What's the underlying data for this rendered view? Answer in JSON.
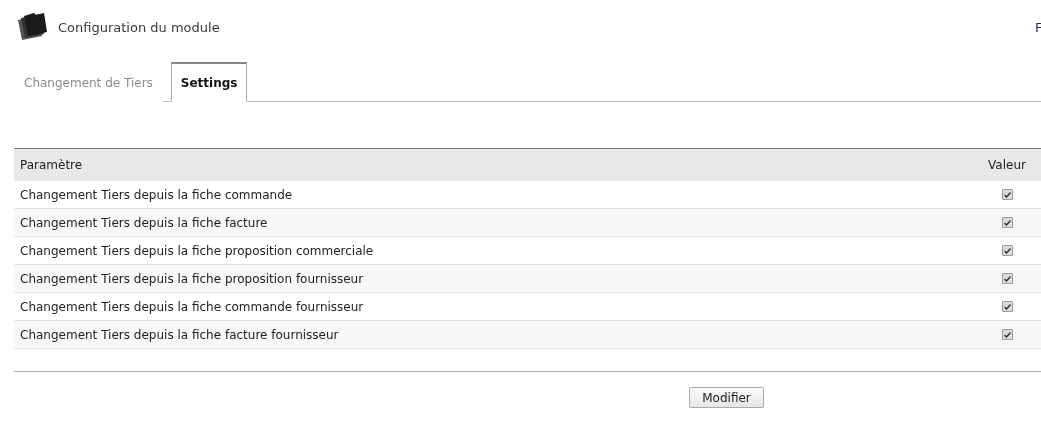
{
  "header": {
    "title": "Configuration du module",
    "right_link": "F"
  },
  "tabs": [
    {
      "label": "Changement de Tiers",
      "selected": false
    },
    {
      "label": "Settings",
      "selected": true
    }
  ],
  "table": {
    "columns": [
      "Paramètre",
      "Valeur"
    ],
    "rows": [
      {
        "label": "Changement Tiers depuis la fiche commande",
        "checked": true
      },
      {
        "label": "Changement Tiers depuis la fiche facture",
        "checked": true
      },
      {
        "label": "Changement Tiers depuis la fiche proposition commerciale",
        "checked": true
      },
      {
        "label": "Changement Tiers depuis la fiche proposition fournisseur",
        "checked": true
      },
      {
        "label": "Changement Tiers depuis la fiche commande fournisseur",
        "checked": true
      },
      {
        "label": "Changement Tiers depuis la fiche facture fournisseur",
        "checked": true
      }
    ]
  },
  "button": "Modifier"
}
